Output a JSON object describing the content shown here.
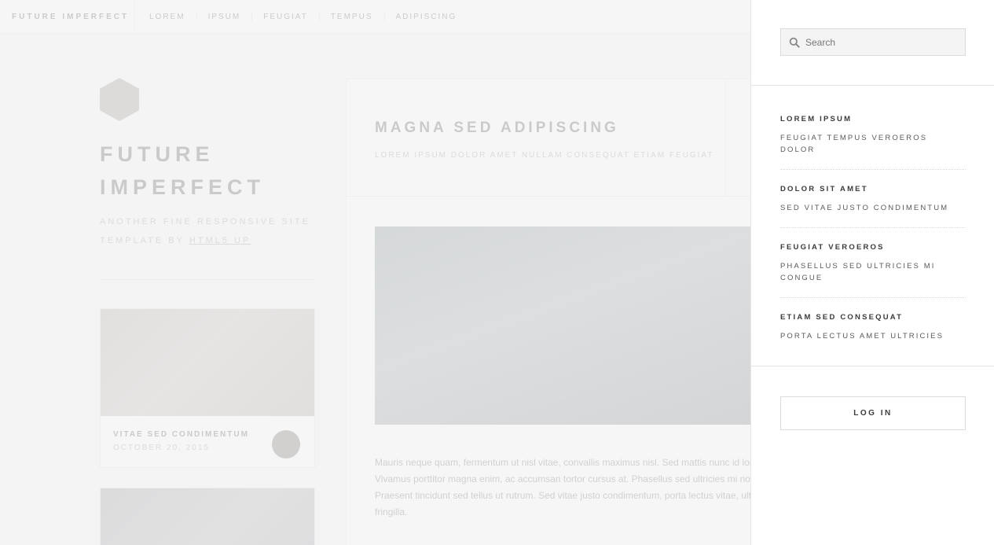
{
  "header": {
    "brand": "FUTURE IMPERFECT",
    "nav": [
      "LOREM",
      "IPSUM",
      "FEUGIAT",
      "TEMPUS",
      "ADIPISCING"
    ]
  },
  "intro": {
    "title": "FUTURE IMPERFECT",
    "subtitle_prefix": "ANOTHER FINE RESPONSIVE SITE TEMPLATE BY ",
    "subtitle_link": "HTML5 UP"
  },
  "mini_posts": [
    {
      "title": "VITAE SED CONDIMENTUM",
      "date": "OCTOBER 20, 2015"
    }
  ],
  "post": {
    "title": "MAGNA SED ADIPISCING",
    "subtitle": "LOREM IPSUM DOLOR AMET NULLAM CONSEQUAT ETIAM FEUGIAT",
    "body": "Mauris neque quam, fermentum ut nisl vitae, convallis maximus nisl. Sed mattis nunc id lorem Vivamus porttitor magna enim, ac accumsan tortor cursus at. Phasellus sed ultricies mi non c Praesent tincidunt sed tellus ut rutrum. Sed vitae justo condimentum, porta lectus vitae, ultr non fringilla."
  },
  "menu": {
    "search_placeholder": "Search",
    "links": [
      {
        "title": "LOREM IPSUM",
        "desc": "FEUGIAT TEMPUS VEROEROS DOLOR"
      },
      {
        "title": "DOLOR SIT AMET",
        "desc": "SED VITAE JUSTO CONDIMENTUM"
      },
      {
        "title": "FEUGIAT VEROEROS",
        "desc": "PHASELLUS SED ULTRICIES MI CONGUE"
      },
      {
        "title": "ETIAM SED CONSEQUAT",
        "desc": "PORTA LECTUS AMET ULTRICIES"
      }
    ],
    "login_label": "LOG IN"
  }
}
